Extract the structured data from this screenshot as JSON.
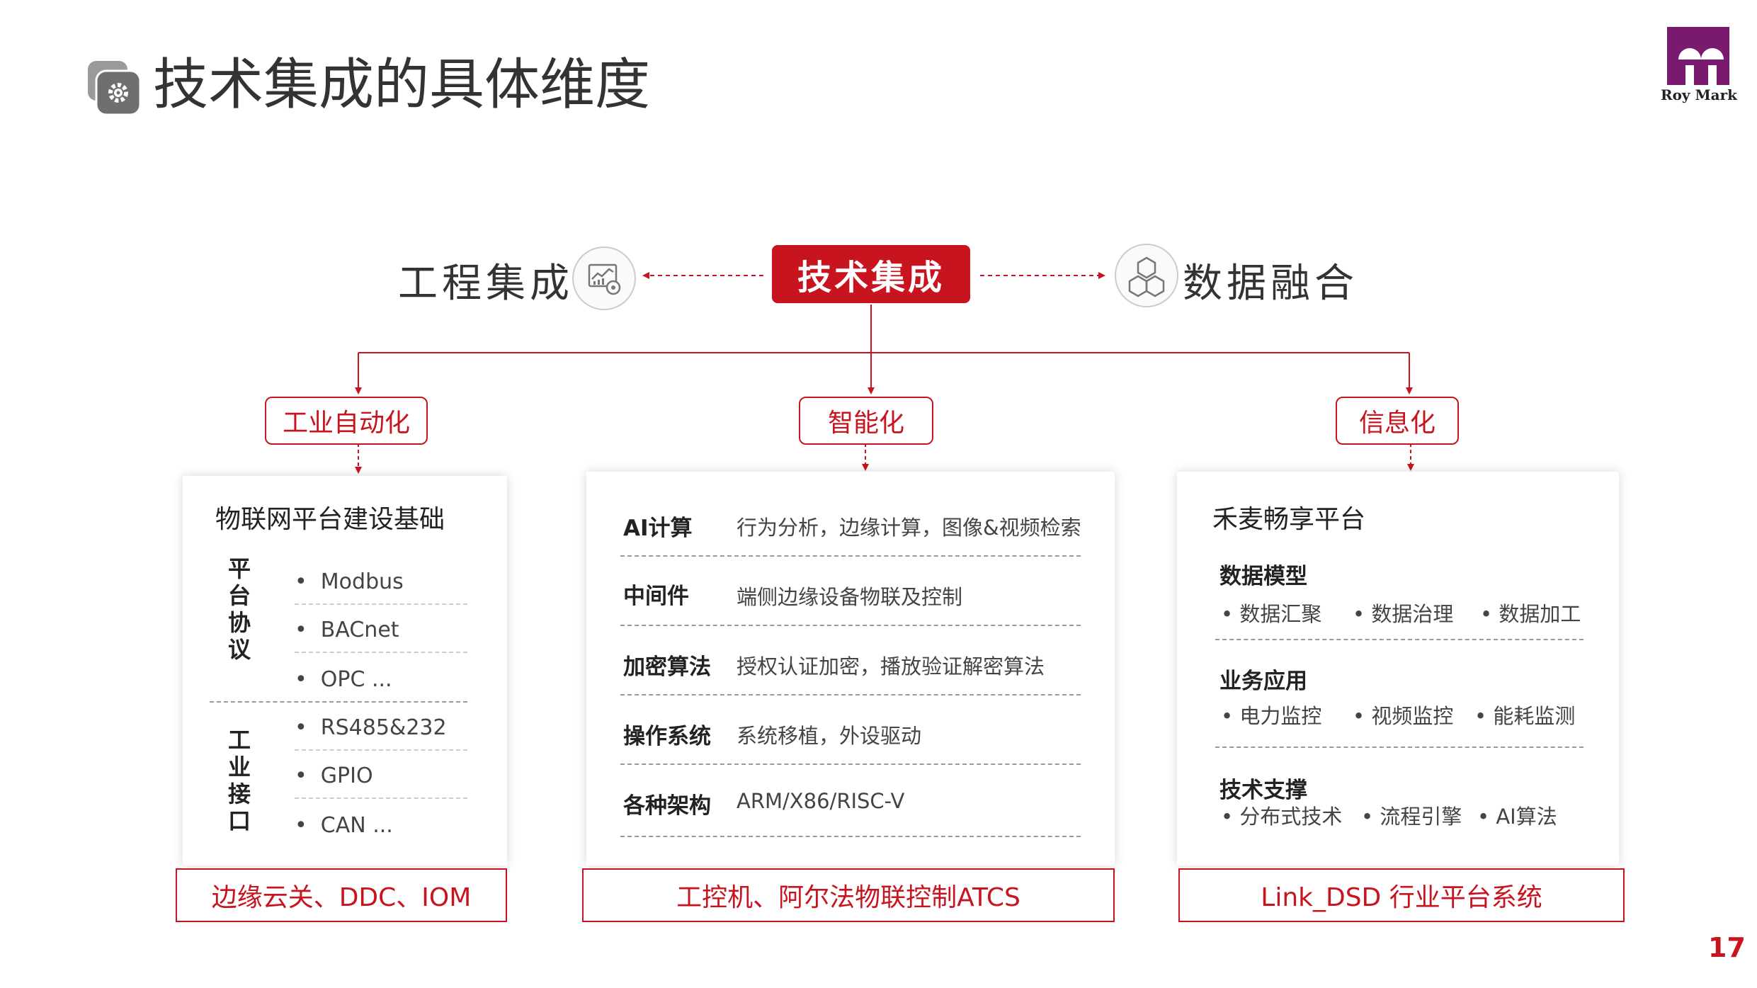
{
  "header": {
    "title": "技术集成的具体维度"
  },
  "logo": {
    "text": "Roy Mark"
  },
  "top": {
    "center": "技术集成",
    "left": "工程集成",
    "right": "数据融合"
  },
  "categories": [
    "工业自动化",
    "智能化",
    "信息化"
  ],
  "panel1": {
    "title": "物联网平台建设基础",
    "group1_label": "平台协议",
    "group1_items": [
      "Modbus",
      "BACnet",
      "OPC ..."
    ],
    "group2_label": "工业接口",
    "group2_items": [
      "RS485&232",
      "GPIO",
      "CAN ..."
    ]
  },
  "panel2": {
    "rows": [
      {
        "label": "AI计算",
        "desc": "行为分析，边缘计算，图像&视频检索"
      },
      {
        "label": "中间件",
        "desc": "端侧边缘设备物联及控制"
      },
      {
        "label": "加密算法",
        "desc": "授权认证加密，播放验证解密算法"
      },
      {
        "label": "操作系统",
        "desc": "系统移植，外设驱动"
      },
      {
        "label": "各种架构",
        "desc": "ARM/X86/RISC-V"
      }
    ]
  },
  "panel3": {
    "title": "禾麦畅享平台",
    "sections": [
      {
        "head": "数据模型",
        "items": [
          "数据汇聚",
          "数据治理",
          "数据加工"
        ]
      },
      {
        "head": "业务应用",
        "items": [
          "电力监控",
          "视频监控",
          "能耗监测"
        ]
      },
      {
        "head": "技术支撑",
        "items": [
          "分布式技术",
          "流程引擎",
          "AI算法"
        ]
      }
    ]
  },
  "bottom": [
    "边缘云关、DDC、IOM",
    "工控机、阿尔法物联控制ATCS",
    "Link_DSD 行业平台系统"
  ],
  "page_number": "17",
  "colors": {
    "accent": "#c8141e",
    "text": "#333333",
    "icon_gray": "#777777",
    "logo_purple": "#7a1a6e"
  }
}
